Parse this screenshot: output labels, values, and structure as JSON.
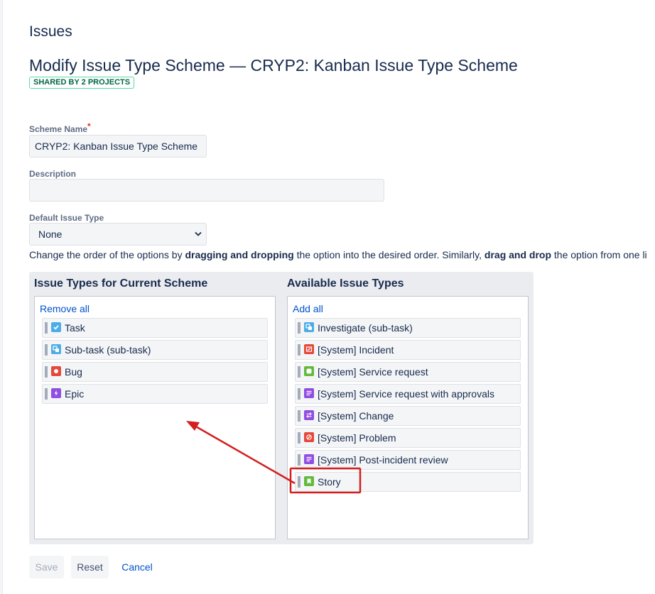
{
  "page": {
    "title": "Issues",
    "scheme_heading": "Modify Issue Type Scheme — CRYP2: Kanban Issue Type Scheme",
    "shared_badge": "SHARED BY 2 PROJECTS"
  },
  "form": {
    "scheme_name_label": "Scheme Name",
    "required_marker": "*",
    "scheme_name_value": "CRYP2: Kanban Issue Type Scheme",
    "description_label": "Description",
    "description_value": "",
    "default_issue_type_label": "Default Issue Type",
    "default_issue_type_value": "None"
  },
  "help": {
    "part1": "Change the order of the options by ",
    "bold1": "dragging and dropping",
    "part2": " the option into the desired order. Similarly, ",
    "bold2": "drag and drop",
    "part3": " the option from one li"
  },
  "current_scheme": {
    "title": "Issue Types for Current Scheme",
    "action": "Remove all",
    "items": [
      {
        "label": "Task",
        "icon": "task-icon",
        "color": "#4bade8"
      },
      {
        "label": "Sub-task (sub-task)",
        "icon": "subtask-icon",
        "color": "#4bade8"
      },
      {
        "label": "Bug",
        "icon": "bug-icon",
        "color": "#e5493a"
      },
      {
        "label": "Epic",
        "icon": "epic-icon",
        "color": "#904ee2"
      }
    ]
  },
  "available": {
    "title": "Available Issue Types",
    "action": "Add all",
    "items": [
      {
        "label": "Investigate (sub-task)",
        "icon": "investigate-icon",
        "color": "#4bade8"
      },
      {
        "label": "[System] Incident",
        "icon": "incident-icon",
        "color": "#e5493a"
      },
      {
        "label": "[System] Service request",
        "icon": "service-request-icon",
        "color": "#63ba3c"
      },
      {
        "label": "[System] Service request with approvals",
        "icon": "service-request-approvals-icon",
        "color": "#904ee2"
      },
      {
        "label": "[System] Change",
        "icon": "change-icon",
        "color": "#904ee2"
      },
      {
        "label": "[System] Problem",
        "icon": "problem-icon",
        "color": "#e5493a"
      },
      {
        "label": "[System] Post-incident review",
        "icon": "post-incident-review-icon",
        "color": "#904ee2"
      },
      {
        "label": "Story",
        "icon": "story-icon",
        "color": "#63ba3c"
      }
    ]
  },
  "buttons": {
    "save": "Save",
    "reset": "Reset",
    "cancel": "Cancel"
  },
  "annotation": {
    "color": "#d21f1f"
  }
}
